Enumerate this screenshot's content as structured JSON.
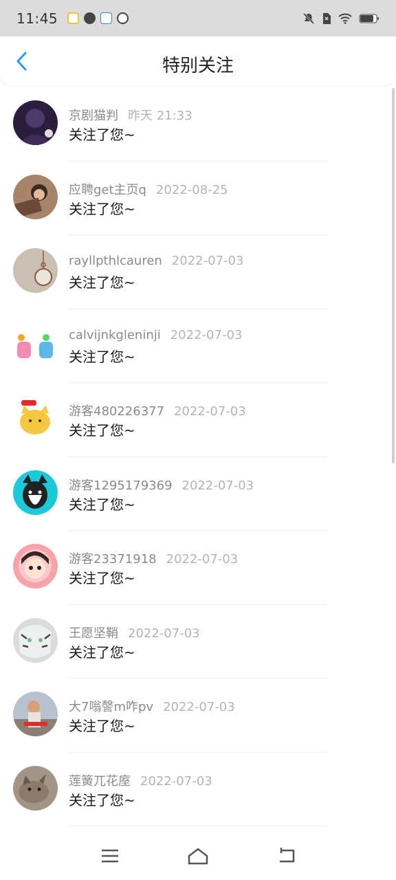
{
  "status_bar": {
    "time": "11:45",
    "app_icons": [
      "notification-app-icon",
      "clock-app-icon",
      "bank-app-icon",
      "cat-app-icon"
    ],
    "system_icons": [
      "mute-icon",
      "sim-icon",
      "wifi-icon",
      "battery-icon"
    ]
  },
  "header": {
    "title": "特别关注",
    "back_icon": "chevron-left-icon",
    "accent_color": "#2e9bf0"
  },
  "list": [
    {
      "name": "京剧猫判",
      "date": "昨天 21:33",
      "message": "关注了您~",
      "avatar_color": "#2a1d3d"
    },
    {
      "name": "应聘get主页q",
      "date": "2022-08-25",
      "message": "关注了您~",
      "avatar_color": "#7a5a45"
    },
    {
      "name": "rayllpthlcauren",
      "date": "2022-07-03",
      "message": "关注了您~",
      "avatar_color": "#c9bfb3"
    },
    {
      "name": "calvijnkgleninji",
      "date": "2022-07-03",
      "message": "关注了您~",
      "avatar_color": "#f0e6e6"
    },
    {
      "name": "游客480226377",
      "date": "2022-07-03",
      "message": "关注了您~",
      "avatar_color": "#f5c842"
    },
    {
      "name": "游客1295179369",
      "date": "2022-07-03",
      "message": "关注了您~",
      "avatar_color": "#1cc9d9"
    },
    {
      "name": "游客23371918",
      "date": "2022-07-03",
      "message": "关注了您~",
      "avatar_color": "#f6a3a9"
    },
    {
      "name": "王愿坚鞘",
      "date": "2022-07-03",
      "message": "关注了您~",
      "avatar_color": "#c9ccca"
    },
    {
      "name": "大7嗡謦m咋pv",
      "date": "2022-07-03",
      "message": "关注了您~",
      "avatar_color": "#8a7f74"
    },
    {
      "name": "莲簧兀花庢",
      "date": "2022-07-03",
      "message": "关注了您~",
      "avatar_color": "#8c7b6c"
    }
  ],
  "bottom_nav": [
    "menu-icon",
    "home-icon",
    "back-icon"
  ]
}
